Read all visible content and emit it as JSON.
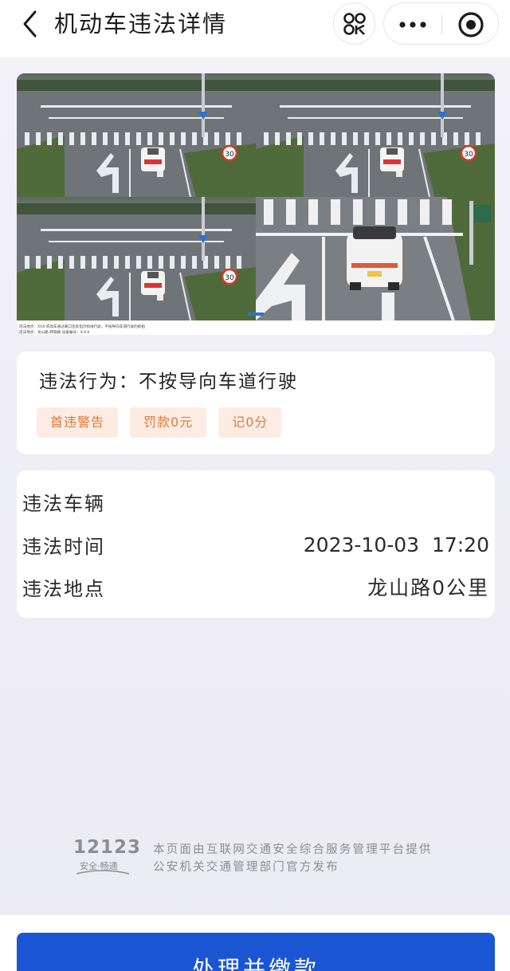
{
  "header": {
    "title": "机动车违法详情",
    "back_icon": "chevron-left-icon",
    "scan_icon": "scan-icon",
    "more_icon": "more-dots-icon",
    "close_icon": "target-close-icon"
  },
  "photo": {
    "caption_line1": "违法地点：XXX 机动车通过路口违反指示标线行驶，不按导向车道行驶的抓拍",
    "caption_line2": "违法地点：龙山路-转塘路  设备编号：X-X-X"
  },
  "violation": {
    "label": "违法行为：",
    "value": "不按导向车道行驶",
    "badges": [
      "首违警告",
      "罚款0元",
      "记0分"
    ]
  },
  "info": {
    "vehicle_label": "违法车辆",
    "vehicle_value": "",
    "time_label": "违法时间",
    "time_value": "2023-10-03  17:20",
    "place_label": "违法地点",
    "place_value": "龙山路0公里"
  },
  "footer": {
    "logo_number": "12123",
    "logo_slogan": "安全·畅通",
    "line1": "本页面由互联网交通安全综合服务管理平台提供",
    "line2": "公安机关交通管理部门官方发布"
  },
  "action": {
    "pay_label": "处理并缴款"
  },
  "colors": {
    "primary": "#1a56d4",
    "badge_bg": "#fdece3",
    "badge_text": "#e07a3c"
  }
}
